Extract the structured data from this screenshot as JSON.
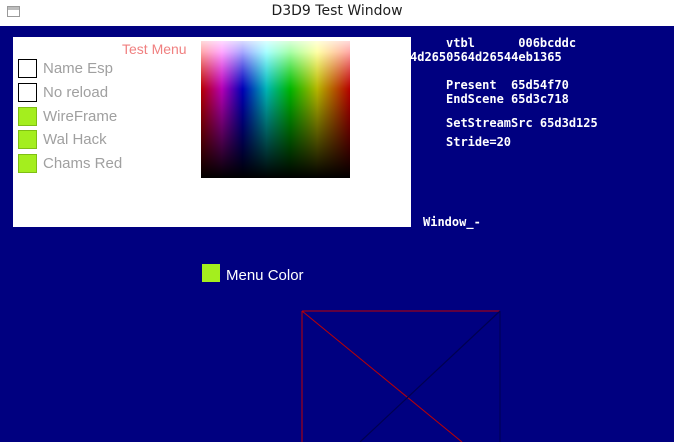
{
  "window": {
    "title": "D3D9 Test Window"
  },
  "menu": {
    "title": "Test Menu",
    "items": [
      {
        "label": "Name Esp",
        "checked": false
      },
      {
        "label": "No reload",
        "checked": false
      },
      {
        "label": "WireFrame",
        "checked": true
      },
      {
        "label": "Wal Hack",
        "checked": true
      },
      {
        "label": "Chams Red",
        "checked": true
      }
    ],
    "menu_color_label": "Menu Color",
    "menu_color": "#a4ee1e"
  },
  "debug": {
    "vtbl_line": "vtbl      006bcddc",
    "addr_line": "4d2650564d26544eb1365",
    "present_line": "Present  65d54f70",
    "endscene_line": "EndScene 65d3c718",
    "stream_line": "SetStreamSrc 65d3d125",
    "stride_line": "Stride=20",
    "window_line": "Window_-"
  },
  "colors": {
    "background": "#000080",
    "menu_title": "#f08080",
    "checked": "#a4ee1e",
    "box_red": "#c00000",
    "box_blue": "#000050"
  }
}
